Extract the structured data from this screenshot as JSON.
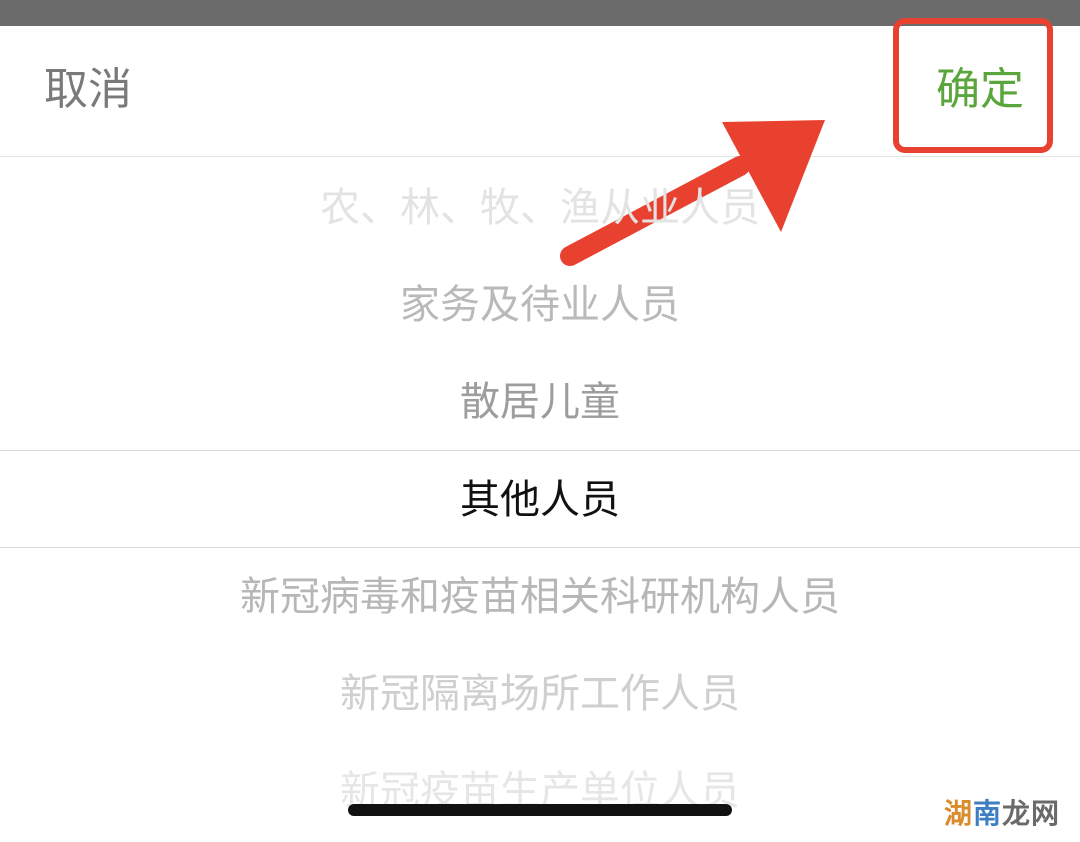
{
  "toolbar": {
    "cancel_label": "取消",
    "confirm_label": "确定"
  },
  "picker": {
    "items": [
      "农、林、牧、渔从业人员",
      "家务及待业人员",
      "散居儿童",
      "其他人员",
      "新冠病毒和疫苗相关科研机构人员",
      "新冠隔离场所工作人员",
      "新冠疫苗生产单位人员"
    ],
    "selected": "其他人员"
  },
  "watermark": {
    "part1": "湖",
    "part2": "南",
    "part3": "龙网"
  },
  "colors": {
    "confirm": "#5aa53c",
    "annotation": "#e8412f"
  }
}
